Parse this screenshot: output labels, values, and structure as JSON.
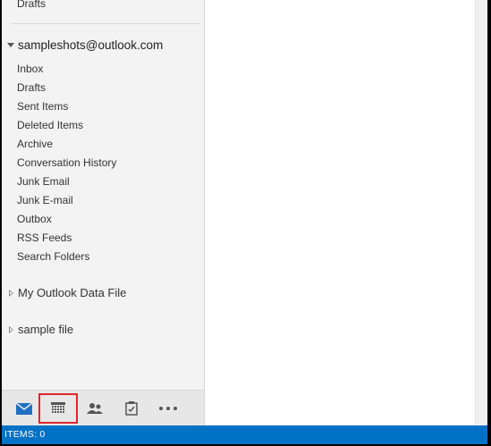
{
  "sidebar": {
    "previous_item": "Drafts",
    "account": "sampleshots@outlook.com",
    "folders": [
      "Inbox",
      "Drafts",
      "Sent Items",
      "Deleted Items",
      "Archive",
      "Conversation History",
      "Junk Email",
      "Junk E-mail",
      "Outbox",
      "RSS Feeds",
      "Search Folders"
    ],
    "groups": [
      "My Outlook Data File",
      "sample file"
    ]
  },
  "navbar": {
    "items": [
      {
        "icon": "mail-icon",
        "active": true
      },
      {
        "icon": "calendar-icon",
        "highlighted": true
      },
      {
        "icon": "people-icon"
      },
      {
        "icon": "tasks-icon"
      },
      {
        "icon": "more-icon"
      }
    ]
  },
  "status": {
    "items_text": "ITEMS: 0"
  },
  "colors": {
    "accent": "#0072c6",
    "highlight": "#e0262b",
    "sidebar_bg": "#f3f3f3"
  }
}
